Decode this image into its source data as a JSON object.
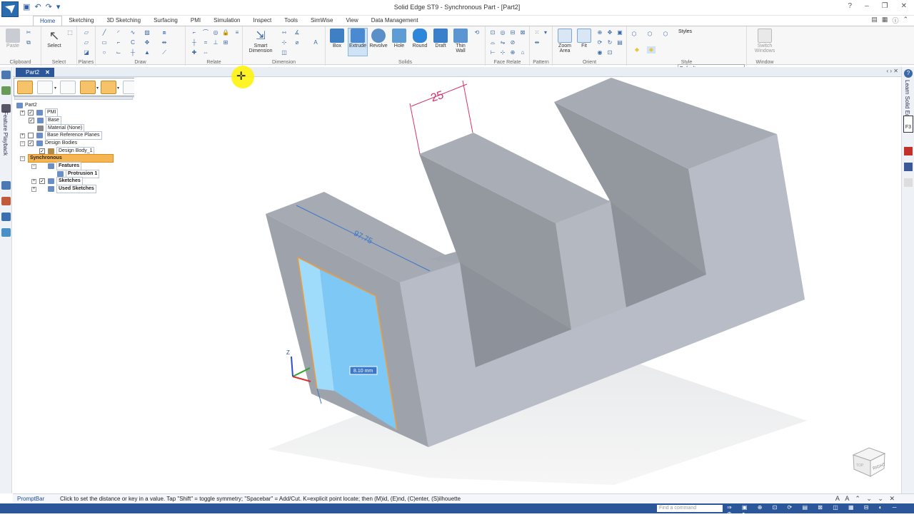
{
  "window": {
    "title": "Solid Edge ST9 - Synchronous Part - [Part2]",
    "controls": [
      "?",
      "–",
      "❐",
      "✕"
    ]
  },
  "ribbon_tabs": [
    "Home",
    "Sketching",
    "3D Sketching",
    "Surfacing",
    "PMI",
    "Simulation",
    "Inspect",
    "Tools",
    "SimWise",
    "View",
    "Data Management"
  ],
  "ribbon": {
    "clipboard": {
      "label": "Clipboard",
      "paste": "Paste"
    },
    "select": {
      "label": "Select",
      "select": "Select"
    },
    "planes": {
      "label": "Planes"
    },
    "draw": {
      "label": "Draw"
    },
    "relate": {
      "label": "Relate"
    },
    "dimension": {
      "label": "Dimension",
      "smart_dimension": "Smart Dimension"
    },
    "solids": {
      "label": "Solids",
      "box": "Box",
      "extrude": "Extrude",
      "revolve": "Revolve",
      "hole": "Hole",
      "round": "Round",
      "draft": "Draft",
      "thin_wall": "Thin Wall"
    },
    "face_relate": {
      "label": "Face Relate"
    },
    "pattern": {
      "label": "Pattern"
    },
    "orient": {
      "label": "Orient",
      "zoom_area": "Zoom Area",
      "fit": "Fit"
    },
    "style": {
      "label": "Style",
      "styles": "Styles",
      "default": "Default"
    },
    "window": {
      "label": "Window",
      "switch_windows": "Switch Windows"
    }
  },
  "document_tab": "Part2",
  "tree": [
    {
      "label": "Part2"
    },
    {
      "label": "PMI"
    },
    {
      "label": "Base"
    },
    {
      "label": "Material (None)"
    },
    {
      "label": "Base Reference Planes"
    },
    {
      "label": "Design Bodies"
    },
    {
      "label": "Design Body_1"
    },
    {
      "label": "Synchronous"
    },
    {
      "label": "Features"
    },
    {
      "label": "Protrusion 1"
    },
    {
      "label": "Sketches"
    },
    {
      "label": "Used Sketches"
    }
  ],
  "side_labels": {
    "left": "Feature Playback",
    "right": "Learn Solid Edge",
    "f3": "F3"
  },
  "viewport": {
    "dim_top": "25",
    "dim_edge": "97.75",
    "dim_input": "8.10 mm",
    "axis_z": "Z",
    "cube_face": "RIGHT",
    "cube_face_top": "TOP"
  },
  "colors": {
    "accent": "#2b579a",
    "model_face_light": "#b9bec8",
    "model_face_dark": "#8f949c",
    "sketch_region": "#7dc8f4"
  },
  "promptbar": {
    "label": "PromptBar",
    "text": "Click to set the distance or key in a value.  Tap \"Shift\" = toggle symmetry; \"Spacebar\" = Add/Cut.  K=explicit point locate; then (M)id, (E)nd, (C)enter, (S)ilhouette"
  },
  "status": {
    "search_placeholder": "Find a command"
  }
}
